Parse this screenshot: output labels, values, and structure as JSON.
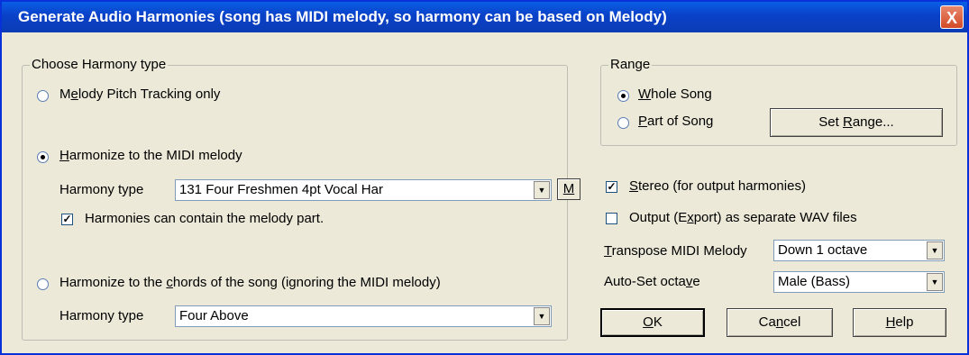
{
  "window": {
    "title": "Generate Audio Harmonies (song has MIDI melody, so harmony can be based on Melody)",
    "close_glyph": "X"
  },
  "harmony_group": {
    "legend": "Choose Harmony type",
    "melody_tracking": {
      "pre": "M",
      "ul": "e",
      "post": "lody Pitch Tracking only",
      "selected": false
    },
    "midi_melody": {
      "pre": "",
      "ul": "H",
      "post": "armonize to the MIDI melody",
      "selected": true
    },
    "harmony_type_label_1": "Harmony type",
    "harmony_type_value_1": "131 Four Freshmen 4pt Vocal Har",
    "m_button": "M",
    "contains_melody": {
      "label": "Harmonies can contain the melody part.",
      "checked": true
    },
    "chords": {
      "pre": "Harmonize to the ",
      "ul": "c",
      "post": "hords of the song    (ignoring the MIDI melody)",
      "selected": false
    },
    "harmony_type_label_2": "Harmony type",
    "harmony_type_value_2": "Four Above"
  },
  "range_group": {
    "legend": "Range",
    "whole_song": {
      "pre": "",
      "ul": "W",
      "post": "hole Song",
      "selected": true
    },
    "part_of_song": {
      "pre": "",
      "ul": "P",
      "post": "art of Song",
      "selected": false
    },
    "set_range": {
      "pre": "Set ",
      "ul": "R",
      "post": "ange..."
    }
  },
  "options": {
    "stereo": {
      "pre": "",
      "ul": "S",
      "post": "tereo (for output harmonies)",
      "checked": true
    },
    "export": {
      "pre": "Output (E",
      "ul": "x",
      "post": "port) as separate WAV files",
      "checked": false
    },
    "transpose": {
      "pre": "",
      "ul": "T",
      "post": "ranspose MIDI Melody",
      "value": "Down 1 octave"
    },
    "autoset": {
      "pre": "Auto-Set octa",
      "ul": "v",
      "post": "e",
      "value": "Male (Bass)"
    }
  },
  "buttons": {
    "ok": {
      "pre": "",
      "ul": "O",
      "post": "K"
    },
    "cancel": {
      "pre": "Ca",
      "ul": "n",
      "post": "cel"
    },
    "help": {
      "pre": "",
      "ul": "H",
      "post": "elp"
    }
  }
}
